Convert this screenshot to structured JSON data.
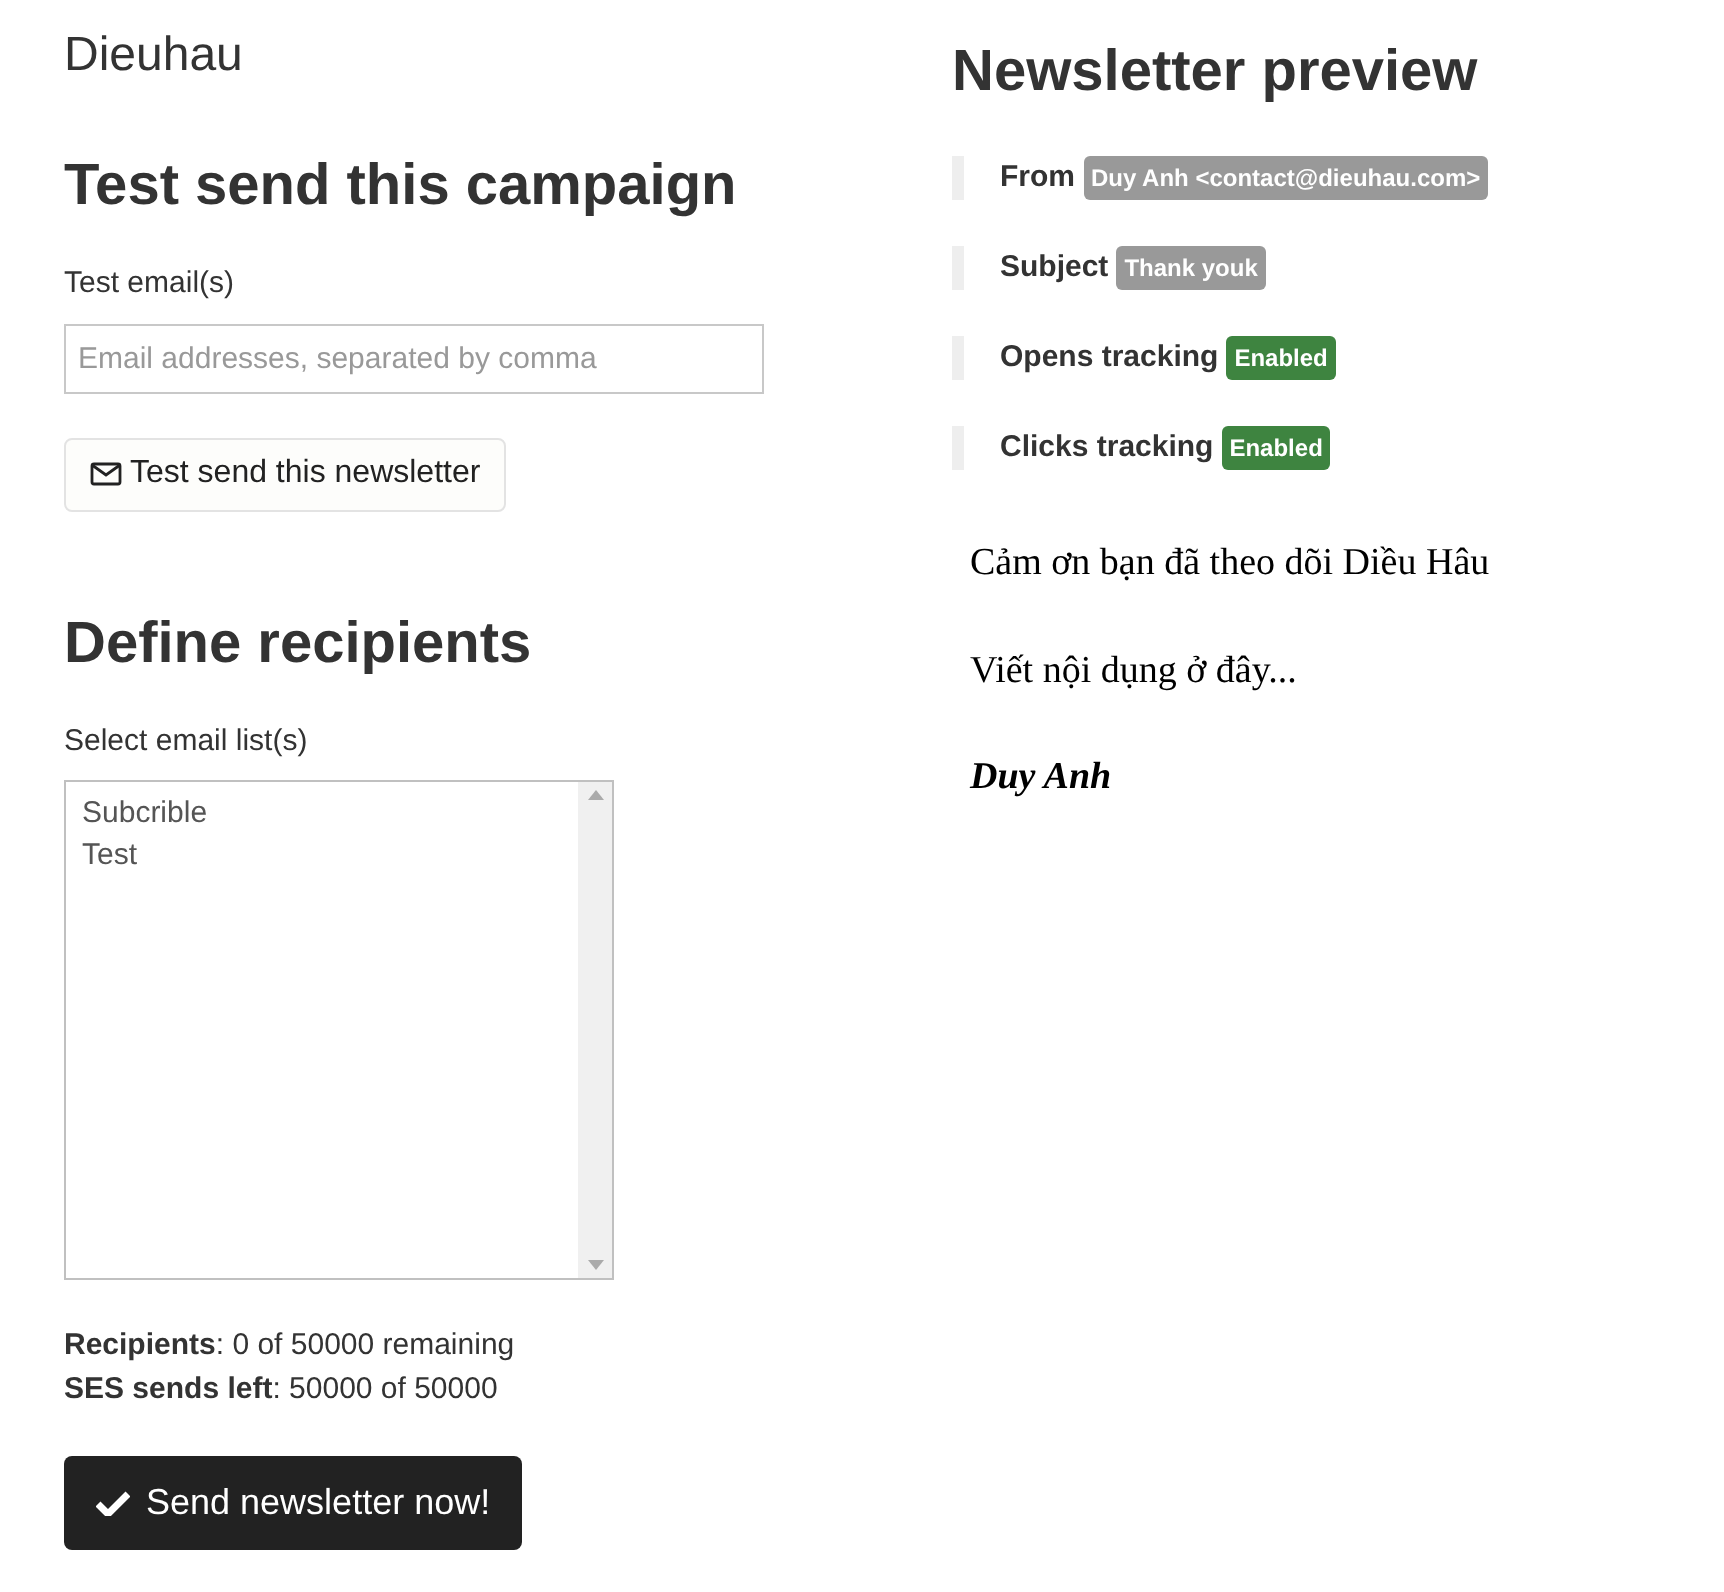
{
  "site_title": "Dieuhau",
  "test_section": {
    "heading": "Test send this campaign",
    "label": "Test email(s)",
    "placeholder": "Email addresses, separated by comma",
    "button": "Test send this newsletter"
  },
  "recipients_section": {
    "heading": "Define recipients",
    "label": "Select email list(s)",
    "lists": [
      {
        "label": "Subcrible",
        "selected": false
      },
      {
        "label": "Test",
        "selected": false
      }
    ],
    "stats": [
      "**Recipients**: 0 of 50000 remaining",
      "**SES sends left**: 50000 of 50000"
    ],
    "send_button": "Send newsletter now!"
  },
  "preview": {
    "heading": "Newsletter preview",
    "meta": [
      {
        "label": "From",
        "value": "Duy Anh <contact@dieuhau.com>",
        "color": "#999999"
      },
      {
        "label": "Subject",
        "value": "Thank youk",
        "color": "#999999"
      },
      {
        "label": "Opens tracking",
        "value": "Enabled",
        "color": "#3e8440"
      },
      {
        "label": "Clicks tracking",
        "value": "Enabled",
        "color": "#3e8440"
      }
    ],
    "body": [
      {
        "kind": "paragraph",
        "text": "Cảm ơn bạn đã theo dõi Diều Hâu"
      },
      {
        "kind": "paragraph",
        "text": "Viết nội dụng ở đây..."
      },
      {
        "kind": "signature",
        "text": "Duy Anh"
      }
    ]
  }
}
